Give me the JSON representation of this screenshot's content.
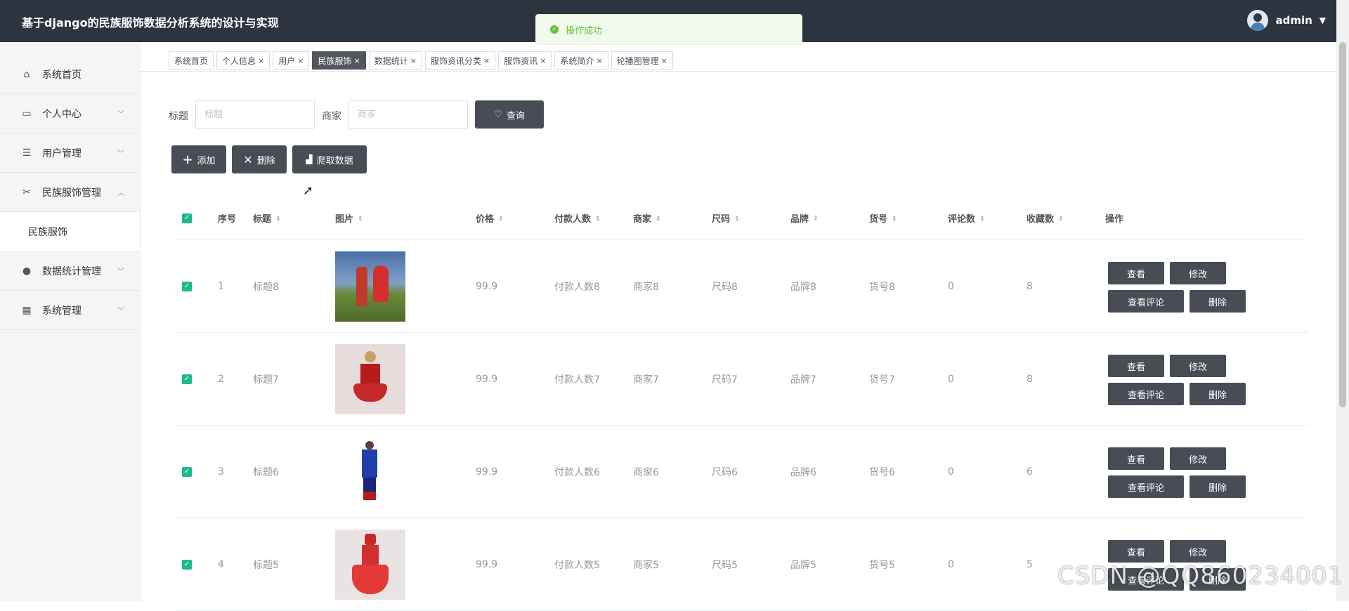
{
  "header": {
    "title": "基于django的民族服饰数据分析系统的设计与实现",
    "user": "admin"
  },
  "toast": {
    "text": "操作成功"
  },
  "sidebar": {
    "items": [
      {
        "label": "系统首页",
        "icon": "home-icon"
      },
      {
        "label": "个人中心",
        "icon": "card-icon"
      },
      {
        "label": "用户管理",
        "icon": "list-icon"
      },
      {
        "label": "民族服饰管理",
        "icon": "ticket-icon"
      },
      {
        "label": "数据统计管理",
        "icon": "balloon-icon"
      },
      {
        "label": "系统管理",
        "icon": "grid-icon"
      }
    ],
    "sub_items": [
      {
        "label": "民族服饰"
      }
    ]
  },
  "tabs": [
    {
      "label": "系统首页",
      "closable": false
    },
    {
      "label": "个人信息",
      "closable": true
    },
    {
      "label": "用户",
      "closable": true
    },
    {
      "label": "民族服饰",
      "closable": true,
      "active": true
    },
    {
      "label": "数据统计",
      "closable": true
    },
    {
      "label": "服饰资讯分类",
      "closable": true
    },
    {
      "label": "服饰资讯",
      "closable": true
    },
    {
      "label": "系统简介",
      "closable": true
    },
    {
      "label": "轮播图管理",
      "closable": true
    }
  ],
  "search": {
    "title_label": "标题",
    "title_placeholder": "标题",
    "shop_label": "商家",
    "shop_placeholder": "商家",
    "query_button": "查询"
  },
  "actions": {
    "add": "添加",
    "delete": "删除",
    "crawl": "爬取数据"
  },
  "table": {
    "headers": {
      "index": "序号",
      "title": "标题",
      "image": "图片",
      "price": "价格",
      "payers": "付款人数",
      "shop": "商家",
      "size": "尺码",
      "brand": "品牌",
      "sku": "货号",
      "comments": "评论数",
      "favorites": "收藏数",
      "ops": "操作"
    },
    "rows": [
      {
        "index": "1",
        "title": "标题8",
        "price": "99.9",
        "payers": "付款人数8",
        "shop": "商家8",
        "size": "尺码8",
        "brand": "品牌8",
        "sku": "货号8",
        "comments": "0",
        "favorites": "8"
      },
      {
        "index": "2",
        "title": "标题7",
        "price": "99.9",
        "payers": "付款人数7",
        "shop": "商家7",
        "size": "尺码7",
        "brand": "品牌7",
        "sku": "货号7",
        "comments": "0",
        "favorites": "8"
      },
      {
        "index": "3",
        "title": "标题6",
        "price": "99.9",
        "payers": "付款人数6",
        "shop": "商家6",
        "size": "尺码6",
        "brand": "品牌6",
        "sku": "货号6",
        "comments": "0",
        "favorites": "6"
      },
      {
        "index": "4",
        "title": "标题5",
        "price": "99.9",
        "payers": "付款人数5",
        "shop": "商家5",
        "size": "尺码5",
        "brand": "品牌5",
        "sku": "货号5",
        "comments": "0",
        "favorites": "5"
      }
    ],
    "op_labels": {
      "view": "查看",
      "edit": "修改",
      "view_comments": "查看评论",
      "delete": "删除"
    }
  },
  "watermark": "CSDN @QQ860234001",
  "colors": {
    "header_bg": "#2e3340",
    "button_bg": "#474c55",
    "checkbox": "#1cb88e",
    "toast": "#67c23a"
  }
}
